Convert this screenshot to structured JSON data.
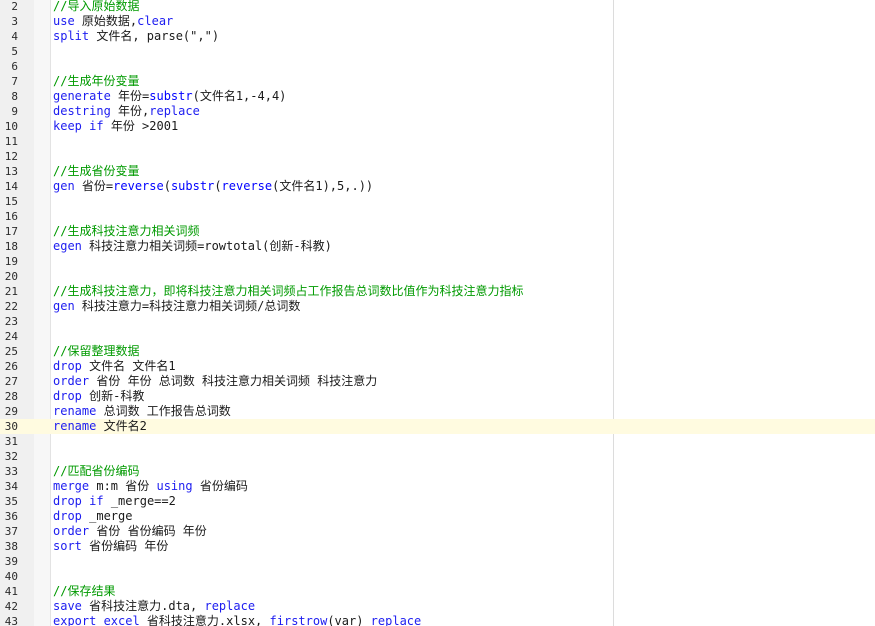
{
  "editor": {
    "current_line": 30,
    "colors": {
      "keyword": "#1d1df0",
      "comment": "#009a00",
      "text": "#1a1a1a",
      "current_line_bg": "#fffbe0",
      "gutter_bg": "#f0f0f0"
    },
    "lines": [
      {
        "n": "2",
        "t": [
          [
            "cm",
            "//导入原始数据"
          ]
        ]
      },
      {
        "n": "3",
        "t": [
          [
            "kw",
            "use"
          ],
          [
            "tx",
            " 原始数据,"
          ],
          [
            "kw",
            "clear"
          ]
        ]
      },
      {
        "n": "4",
        "t": [
          [
            "kw",
            "split"
          ],
          [
            "tx",
            " 文件名, parse(\",\")"
          ]
        ]
      },
      {
        "n": "5",
        "t": []
      },
      {
        "n": "6",
        "t": []
      },
      {
        "n": "7",
        "t": [
          [
            "cm",
            "//生成年份变量"
          ]
        ]
      },
      {
        "n": "8",
        "t": [
          [
            "kw",
            "generate"
          ],
          [
            "tx",
            " 年份="
          ],
          [
            "fn",
            "substr"
          ],
          [
            "tx",
            "(文件名1,-4,4)"
          ]
        ]
      },
      {
        "n": "9",
        "t": [
          [
            "kw",
            "destring"
          ],
          [
            "tx",
            " 年份,"
          ],
          [
            "kw",
            "replace"
          ]
        ]
      },
      {
        "n": "10",
        "t": [
          [
            "kw",
            "keep"
          ],
          [
            "tx",
            " "
          ],
          [
            "kw",
            "if"
          ],
          [
            "tx",
            " 年份 >2001"
          ]
        ]
      },
      {
        "n": "11",
        "t": []
      },
      {
        "n": "12",
        "t": []
      },
      {
        "n": "13",
        "t": [
          [
            "cm",
            "//生成省份变量"
          ]
        ]
      },
      {
        "n": "14",
        "t": [
          [
            "kw",
            "gen"
          ],
          [
            "tx",
            " 省份="
          ],
          [
            "fn",
            "reverse"
          ],
          [
            "tx",
            "("
          ],
          [
            "fn",
            "substr"
          ],
          [
            "tx",
            "("
          ],
          [
            "fn",
            "reverse"
          ],
          [
            "tx",
            "(文件名1),5,.))"
          ]
        ]
      },
      {
        "n": "15",
        "t": []
      },
      {
        "n": "16",
        "t": []
      },
      {
        "n": "17",
        "t": [
          [
            "cm",
            "//生成科技注意力相关词频"
          ]
        ]
      },
      {
        "n": "18",
        "t": [
          [
            "kw",
            "egen"
          ],
          [
            "tx",
            " 科技注意力相关词频=rowtotal(创新-科教)"
          ]
        ]
      },
      {
        "n": "19",
        "t": []
      },
      {
        "n": "20",
        "t": []
      },
      {
        "n": "21",
        "t": [
          [
            "cm",
            "//生成科技注意力，即将科技注意力相关词频占工作报告总词数比值作为科技注意力指标"
          ]
        ]
      },
      {
        "n": "22",
        "t": [
          [
            "kw",
            "gen"
          ],
          [
            "tx",
            " 科技注意力=科技注意力相关词频/总词数"
          ]
        ]
      },
      {
        "n": "23",
        "t": []
      },
      {
        "n": "24",
        "t": []
      },
      {
        "n": "25",
        "t": [
          [
            "cm",
            "//保留整理数据"
          ]
        ]
      },
      {
        "n": "26",
        "t": [
          [
            "kw",
            "drop"
          ],
          [
            "tx",
            " 文件名 文件名1"
          ]
        ]
      },
      {
        "n": "27",
        "t": [
          [
            "kw",
            "order"
          ],
          [
            "tx",
            " 省份 年份 总词数 科技注意力相关词频 科技注意力"
          ]
        ]
      },
      {
        "n": "28",
        "t": [
          [
            "kw",
            "drop"
          ],
          [
            "tx",
            " 创新-科教"
          ]
        ]
      },
      {
        "n": "29",
        "t": [
          [
            "kw",
            "rename"
          ],
          [
            "tx",
            " 总词数 工作报告总词数"
          ]
        ]
      },
      {
        "n": "30",
        "t": [
          [
            "kw",
            "rename"
          ],
          [
            "tx",
            " 文件名2"
          ]
        ]
      },
      {
        "n": "31",
        "t": []
      },
      {
        "n": "32",
        "t": []
      },
      {
        "n": "33",
        "t": [
          [
            "cm",
            "//匹配省份编码"
          ]
        ]
      },
      {
        "n": "34",
        "t": [
          [
            "kw",
            "merge"
          ],
          [
            "tx",
            " m:m 省份 "
          ],
          [
            "kw",
            "using"
          ],
          [
            "tx",
            " 省份编码"
          ]
        ]
      },
      {
        "n": "35",
        "t": [
          [
            "kw",
            "drop"
          ],
          [
            "tx",
            " "
          ],
          [
            "kw",
            "if"
          ],
          [
            "tx",
            " _merge==2"
          ]
        ]
      },
      {
        "n": "36",
        "t": [
          [
            "kw",
            "drop"
          ],
          [
            "tx",
            " _merge"
          ]
        ]
      },
      {
        "n": "37",
        "t": [
          [
            "kw",
            "order"
          ],
          [
            "tx",
            " 省份 省份编码 年份"
          ]
        ]
      },
      {
        "n": "38",
        "t": [
          [
            "kw",
            "sort"
          ],
          [
            "tx",
            " 省份编码 年份"
          ]
        ]
      },
      {
        "n": "39",
        "t": []
      },
      {
        "n": "40",
        "t": []
      },
      {
        "n": "41",
        "t": [
          [
            "cm",
            "//保存结果"
          ]
        ]
      },
      {
        "n": "42",
        "t": [
          [
            "kw",
            "save"
          ],
          [
            "tx",
            " 省科技注意力.dta, "
          ],
          [
            "kw",
            "replace"
          ]
        ]
      },
      {
        "n": "43",
        "t": [
          [
            "kw",
            "export excel"
          ],
          [
            "tx",
            " 省科技注意力.xlsx, "
          ],
          [
            "kw",
            "firstrow"
          ],
          [
            "tx",
            "(var) "
          ],
          [
            "kw",
            "replace"
          ]
        ]
      }
    ]
  }
}
